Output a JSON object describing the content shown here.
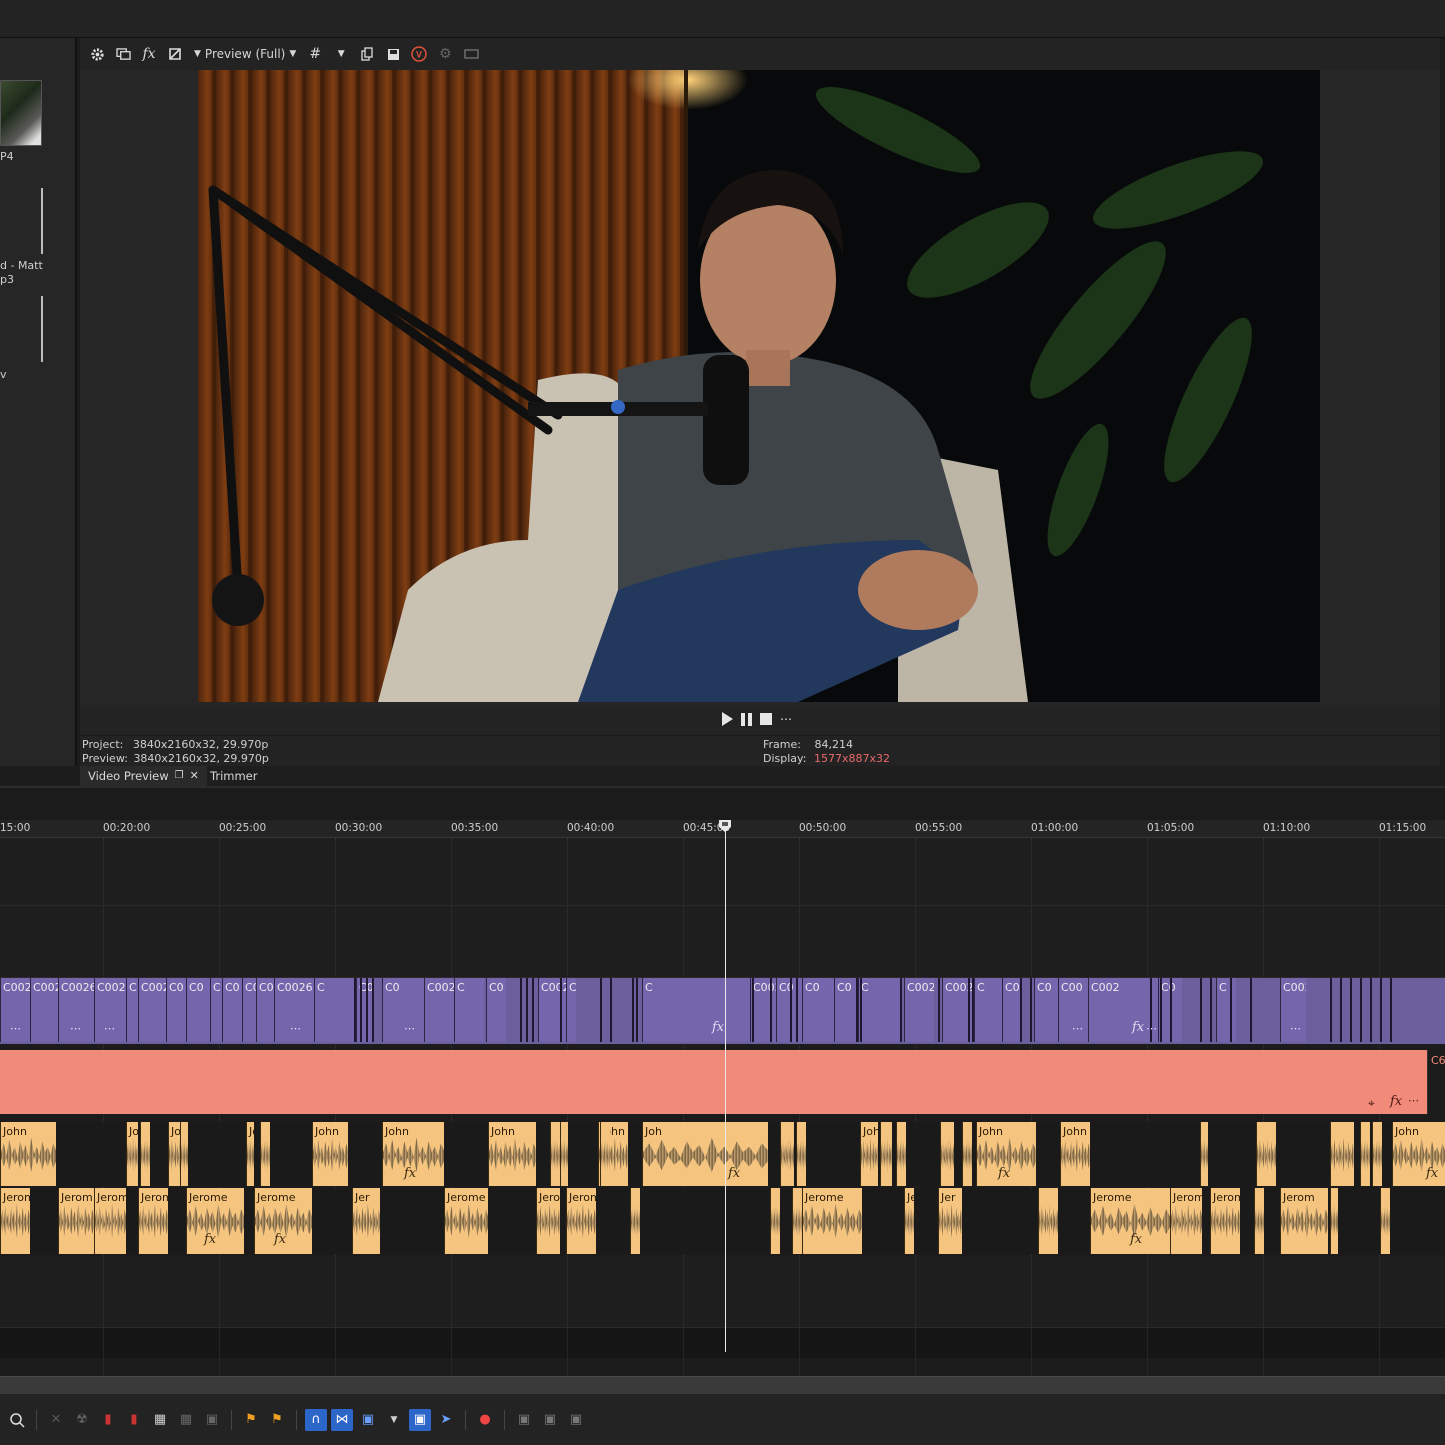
{
  "media_panel": {
    "items": [
      {
        "label": "P4"
      },
      {
        "label": "d - Matt"
      },
      {
        "label": "p3"
      },
      {
        "label": "v"
      }
    ]
  },
  "preview_toolbar": {
    "preview_mode": "Preview (Full)",
    "icons": [
      "gear-icon",
      "external-monitor-icon",
      "fx-icon",
      "split-screen-icon",
      "preview-quality-dropdown",
      "grid-icon",
      "grid-dropdown",
      "copy-snapshot-icon",
      "save-snapshot-icon",
      "vegas-logo-icon",
      "record-icon",
      "overlay-icon"
    ]
  },
  "info": {
    "project_label": "Project:",
    "project_value": "3840x2160x32, 29.970p",
    "preview_label": "Preview:",
    "preview_value": "3840x2160x32, 29.970p",
    "frame_label": "Frame:",
    "frame_value": "84,214",
    "display_label": "Display:",
    "display_value": "1577x887x32"
  },
  "tabs": [
    {
      "label": "Video Preview"
    },
    {
      "label": "Trimmer"
    }
  ],
  "ruler": {
    "ticks": [
      "15:00",
      "00:20:00",
      "00:25:00",
      "00:30:00",
      "00:35:00",
      "00:40:00",
      "00:45:00",
      "00:50:00",
      "00:55:00",
      "01:00:00",
      "01:05:00",
      "01:10:00",
      "01:15:00"
    ]
  },
  "video_track": {
    "clips": [
      {
        "label": "C002"
      },
      {
        "label": "C002"
      },
      {
        "label": "C0026"
      },
      {
        "label": "C002"
      },
      {
        "label": "C"
      },
      {
        "label": "C002"
      },
      {
        "label": "C0"
      },
      {
        "label": "C0"
      },
      {
        "label": "C"
      },
      {
        "label": "C0"
      },
      {
        "label": "C0"
      },
      {
        "label": "C0026"
      },
      {
        "label": "C0026"
      },
      {
        "label": "C"
      },
      {
        "label": "C0026"
      },
      {
        "label": "C0"
      },
      {
        "label": "C002"
      },
      {
        "label": "C"
      },
      {
        "label": "C0"
      },
      {
        "label": "C0026"
      },
      {
        "label": "C0"
      },
      {
        "label": "C"
      },
      {
        "label": "C002"
      },
      {
        "label": "C0"
      },
      {
        "label": "C0"
      },
      {
        "label": "C0"
      },
      {
        "label": "C"
      },
      {
        "label": "C002"
      },
      {
        "label": "C0026"
      },
      {
        "label": "C"
      },
      {
        "label": "C002"
      },
      {
        "label": "C0"
      },
      {
        "label": "C00"
      },
      {
        "label": "C002"
      },
      {
        "label": "C0"
      },
      {
        "label": "C"
      },
      {
        "label": "C002"
      }
    ],
    "fx_label": "fx"
  },
  "pink_track": {
    "end_label": "C6",
    "fx_label": "fx"
  },
  "audio_track_1": {
    "clips": [
      {
        "label": "John"
      },
      {
        "label": "John"
      },
      {
        "label": "John"
      },
      {
        "label": "John"
      },
      {
        "label": "John"
      },
      {
        "label": "John"
      },
      {
        "label": "John"
      },
      {
        "label": "John"
      },
      {
        "label": "Joh"
      },
      {
        "label": "John"
      },
      {
        "label": "John"
      },
      {
        "label": "John"
      },
      {
        "label": "John"
      }
    ],
    "fx_label": "fx"
  },
  "audio_track_2": {
    "clips": [
      {
        "label": "Jerom"
      },
      {
        "label": "Jerom"
      },
      {
        "label": "Jerom"
      },
      {
        "label": "Jerom"
      },
      {
        "label": "Jerome"
      },
      {
        "label": "Jerome"
      },
      {
        "label": "Jer"
      },
      {
        "label": "Jerome"
      },
      {
        "label": "Jero"
      },
      {
        "label": "Jerom"
      },
      {
        "label": "Jerome"
      },
      {
        "label": "Jer"
      },
      {
        "label": "Jer"
      },
      {
        "label": "Jerome"
      },
      {
        "label": "Jerom"
      },
      {
        "label": "Jerom"
      },
      {
        "label": "Jerom"
      }
    ],
    "fx_label": "fx"
  },
  "colors": {
    "video_track": "#7565ad",
    "pink_track": "#f28a7a",
    "audio_clip": "#f5c580",
    "accent": "#2d66c9",
    "display_value": "#e86a6a"
  },
  "bottom_toolbar": {
    "icons": [
      "zoom-icon",
      "delete-icon",
      "trim-icon",
      "trim-start-icon",
      "trim-end-icon",
      "split-icon",
      "ignore-grouping-icon",
      "lock-icon",
      "marker-icon",
      "region-icon",
      "snapping-icon",
      "auto-crossfade-icon",
      "auto-ripple-icon",
      "auto-ripple-dropdown",
      "lock-envelopes-icon",
      "selection-tool-icon",
      "color-match-icon",
      "nest-icon",
      "group-icon",
      "ungroup-icon"
    ]
  }
}
